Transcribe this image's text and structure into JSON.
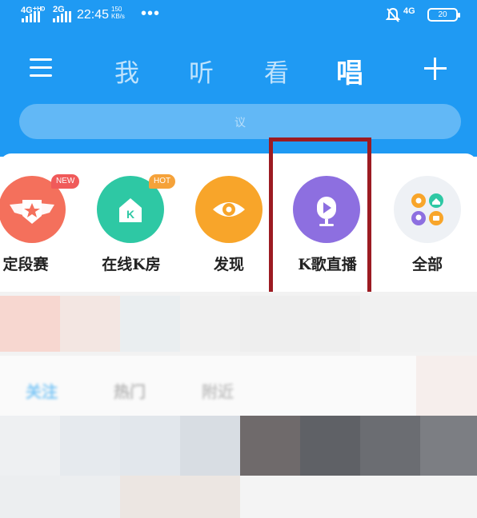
{
  "status_bar": {
    "network_primary": "4G⁺ᴴᴰ",
    "network_secondary": "2G",
    "time": "22:45",
    "speed_value": "150",
    "speed_unit": "KB/s",
    "more": "•••",
    "network_right": "4G",
    "battery": "20"
  },
  "nav": {
    "tabs": [
      "我",
      "听",
      "看",
      "唱"
    ],
    "active_tab": "唱"
  },
  "search": {
    "placeholder": "议"
  },
  "entries": [
    {
      "label": "定段赛",
      "badge": "NEW",
      "color": "#f4705c",
      "icon": "star-wings-icon"
    },
    {
      "label": "在线K房",
      "badge": "HOT",
      "color": "#2ec8a4",
      "icon": "k-house-icon"
    },
    {
      "label": "发现",
      "badge": "",
      "color": "#f8a52a",
      "icon": "eye-icon"
    },
    {
      "label": "K歌直播",
      "badge": "",
      "color": "#8d6fe0",
      "icon": "live-video-icon"
    },
    {
      "label": "全部",
      "badge": "",
      "color": "#eef1f5",
      "icon": "grid-apps-icon"
    }
  ],
  "feed_tabs": [
    "关注",
    "热门",
    "附近"
  ],
  "colors": {
    "header_blue": "#1f9af3",
    "highlight_red": "#9c1b22"
  }
}
